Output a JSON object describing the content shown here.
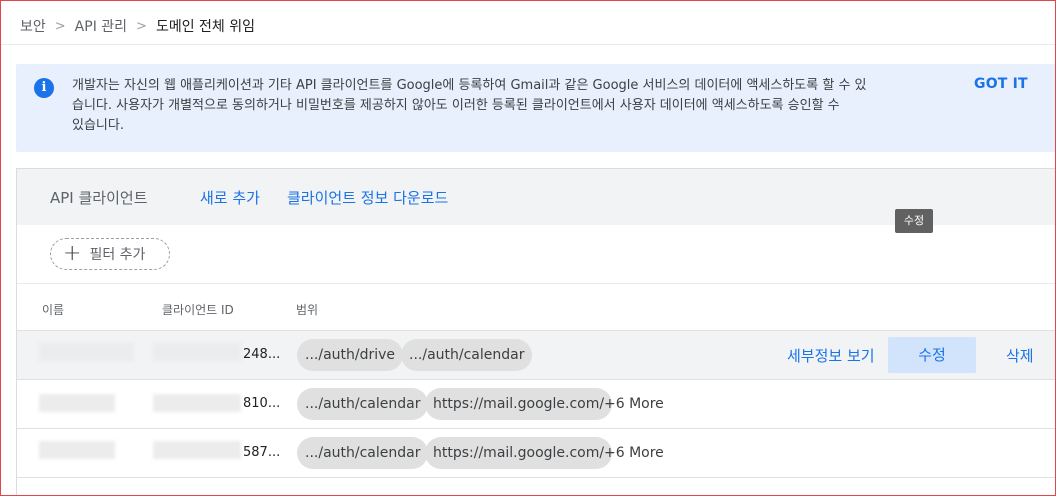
{
  "breadcrumb": {
    "items": [
      "보안",
      "API 관리",
      "도메인 전체 위임"
    ],
    "separator": ">"
  },
  "banner": {
    "icon": "info-icon",
    "line1": "개발자는 자신의 웹 애플리케이션과 기타 API 클라이언트를 Google에 등록하여 Gmail과 같은 Google 서비스의 데이터에 액세스하도록 할 수 있",
    "line2": "습니다. 사용자가 개별적으로 동의하거나 비밀번호를 제공하지 않아도 이러한 등록된 클라이언트에서 사용자 데이터에 액세스하도록 승인할 수",
    "line3": "있습니다.",
    "got_it": "GOT IT"
  },
  "card": {
    "title": "API 클라이언트",
    "add_new": "새로 추가",
    "download": "클라이언트 정보 다운로드",
    "filter_label": "필터 추가"
  },
  "table": {
    "columns": [
      "이름",
      "클라이언트 ID",
      "범위"
    ],
    "rows": [
      {
        "id_suffix": "248...",
        "scopes": [
          ".../auth/drive",
          ".../auth/calendar"
        ],
        "more": "",
        "actions": {
          "details": "세부정보 보기",
          "edit": "수정",
          "delete": "삭제"
        }
      },
      {
        "id_suffix": "810...",
        "scopes": [
          ".../auth/calendar",
          "https://mail.google.com/"
        ],
        "more": "+6 More"
      },
      {
        "id_suffix": "587...",
        "scopes": [
          ".../auth/calendar",
          "https://mail.google.com/"
        ],
        "more": "+6 More"
      }
    ]
  },
  "tooltip": "수정",
  "colors": {
    "accent": "#1a73e8",
    "banner_bg": "#e8f0fe",
    "chip_bg": "#e0e0e0",
    "edit_bg": "#d2e3fc",
    "frame": "#e0474c"
  }
}
